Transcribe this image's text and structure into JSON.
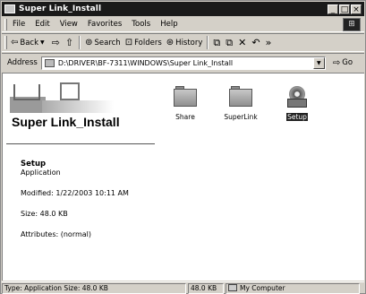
{
  "window": {
    "title": "Super Link_Install",
    "controls": {
      "minimize": "_",
      "maximize": "□",
      "close": "×"
    }
  },
  "menubar": {
    "items": [
      "File",
      "Edit",
      "View",
      "Favorites",
      "Tools",
      "Help"
    ]
  },
  "toolbar": {
    "back_label": "Back",
    "forward_icon": "⇨",
    "up_icon": "⇧",
    "search_label": "Search",
    "folders_label": "Folders",
    "history_label": "History",
    "overflow": "»"
  },
  "addressbar": {
    "label": "Address",
    "value": "D:\\DRIVER\\BF-7311\\WINDOWS\\Super Link_Install",
    "go_label": "Go"
  },
  "content": {
    "folder_title": "Super Link_Install",
    "details": {
      "name": "Setup",
      "type": "Application",
      "modified": "Modified: 1/22/2003 10:11 AM",
      "size": "Size: 48.0 KB",
      "attributes": "Attributes: (normal)"
    },
    "files": [
      {
        "label": "Share",
        "kind": "folder",
        "selected": false
      },
      {
        "label": "SuperLink",
        "kind": "folder",
        "selected": false
      },
      {
        "label": "Setup",
        "kind": "application",
        "selected": true
      }
    ]
  },
  "statusbar": {
    "info": "Type: Application Size: 48.0 KB",
    "size": "48.0 KB",
    "zone": "My Computer"
  },
  "icons": {
    "title": "folder-window-icon",
    "back": "back-arrow-icon",
    "search": "search-icon",
    "folders": "folders-icon",
    "history": "history-icon",
    "go": "go-arrow-icon",
    "zone": "computer-icon"
  }
}
